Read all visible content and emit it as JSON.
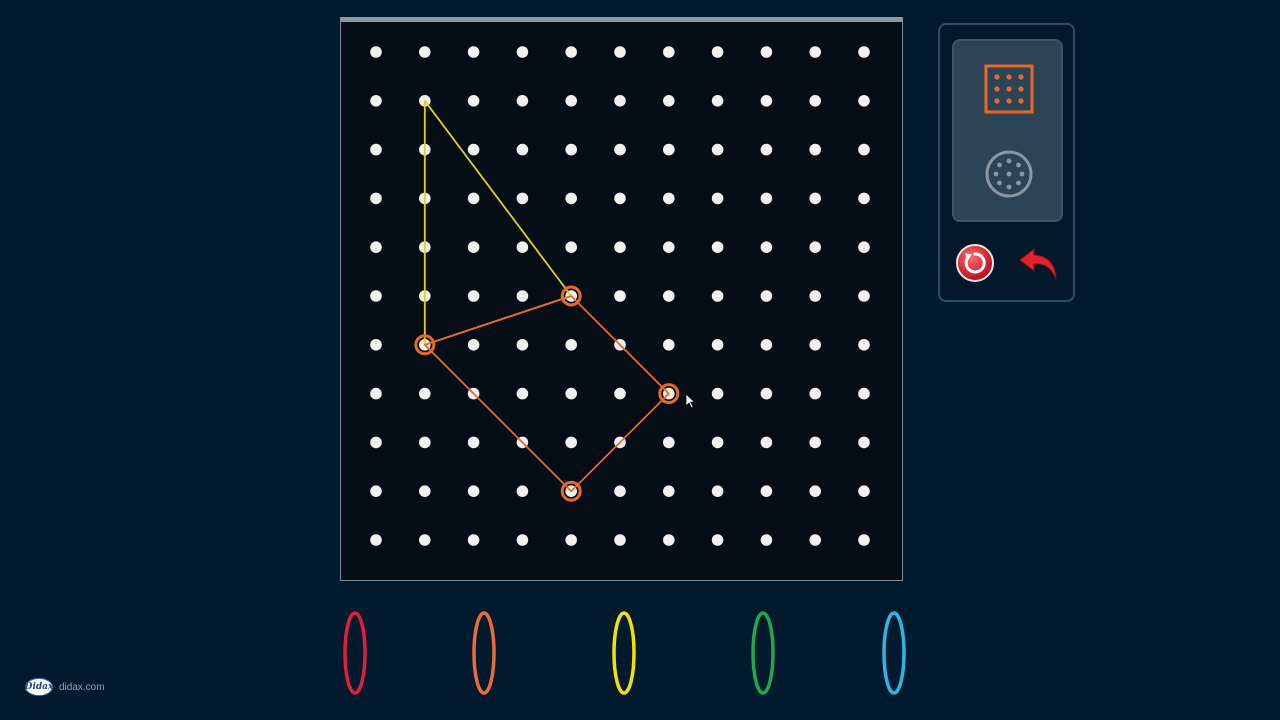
{
  "geoboard": {
    "rows": 11,
    "cols": 11,
    "peg_color": "#f0f0f0",
    "shapes": [
      {
        "band": "yellow",
        "color": "#e4d01c",
        "pegs": [
          [
            1,
            1
          ],
          [
            5,
            4
          ],
          [
            6,
            1
          ]
        ]
      },
      {
        "band": "orange",
        "color": "#e8692a",
        "pegs": [
          [
            6,
            1
          ],
          [
            5,
            4
          ],
          [
            7,
            6
          ],
          [
            9,
            4
          ]
        ]
      }
    ],
    "selected_pegs": [
      [
        5,
        4
      ],
      [
        6,
        1
      ],
      [
        7,
        6
      ],
      [
        9,
        4
      ]
    ]
  },
  "toolbar": {
    "modes": [
      {
        "id": "square-grid",
        "icon": "square-geoboard-icon",
        "active": true,
        "color": "#e8692a"
      },
      {
        "id": "circle-board",
        "icon": "circular-geoboard-icon",
        "active": false,
        "color": "#8a97a3"
      }
    ],
    "actions": [
      {
        "id": "reset",
        "icon": "reset-icon"
      },
      {
        "id": "undo",
        "icon": "undo-arrow-icon"
      }
    ]
  },
  "bands": [
    {
      "name": "red",
      "color": "#e01f3d"
    },
    {
      "name": "orange",
      "color": "#ec6b3d"
    },
    {
      "name": "yellow",
      "color": "#f5e100"
    },
    {
      "name": "green",
      "color": "#22a84a"
    },
    {
      "name": "blue",
      "color": "#2ab6e8"
    }
  ],
  "footer": {
    "logo_text": "Didax",
    "site": "didax.com"
  }
}
